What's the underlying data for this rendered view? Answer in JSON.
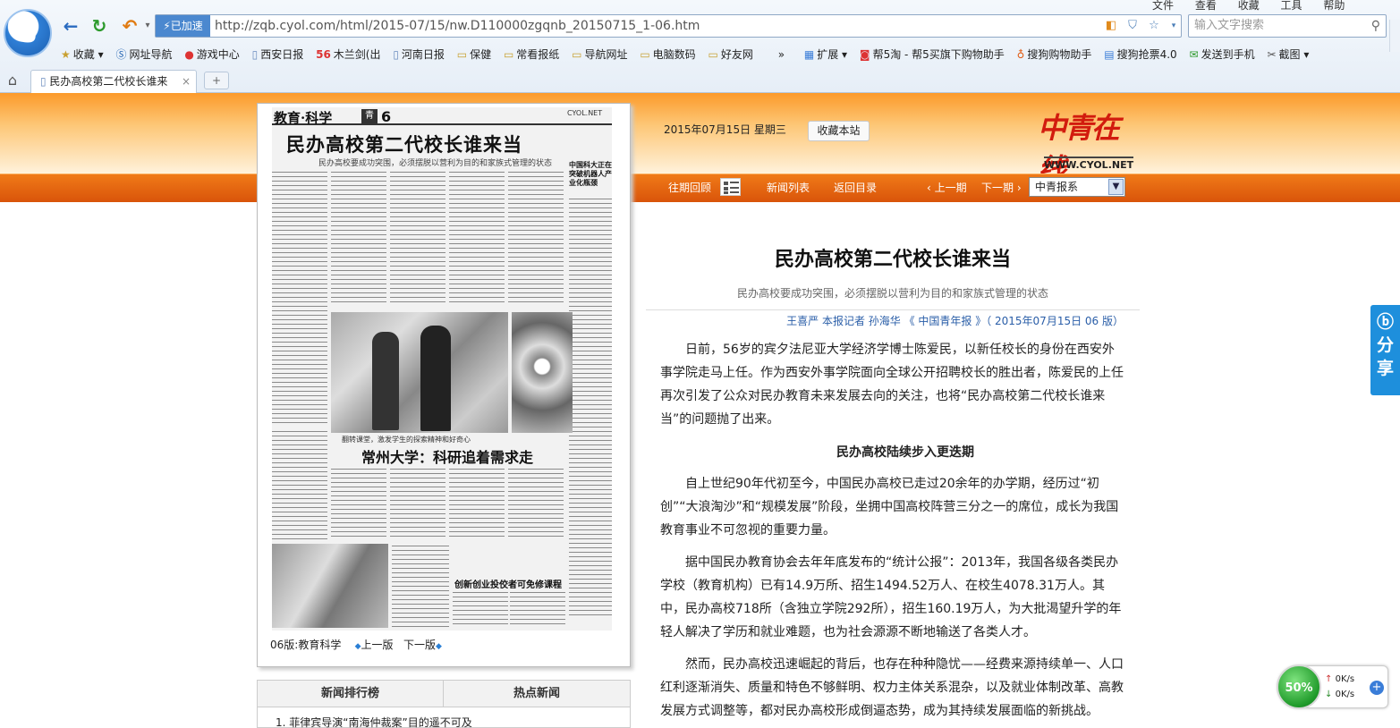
{
  "browser": {
    "speedup_label": "已加速",
    "url": "http://zqb.cyol.com/html/2015-07/15/nw.D110000zgqnb_20150715_1-06.htm",
    "search_placeholder": "输入文字搜索",
    "menu": [
      "文件",
      "查看",
      "收藏",
      "工具",
      "帮助"
    ],
    "bookmarks": [
      "收藏",
      "网址导航",
      "游戏中心",
      "西安日报",
      "木兰剑(出",
      "河南日报",
      "保健",
      "常看报纸",
      "导航网址",
      "电脑数码",
      "好友网",
      "»",
      "扩展",
      "帮5淘 - 帮5买旗下购物助手",
      "搜狗购物助手",
      "搜狗抢票4.0",
      "发送到手机",
      "截图"
    ],
    "tab_title": "民办高校第二代校长谁来",
    "new_tab": "+"
  },
  "site": {
    "date": "2015年07月15日  星期三",
    "favorite_button": "收藏本站",
    "brand": "中青在线",
    "brand_url": "WWW.CYOL.NET",
    "nav": {
      "past": "往期回顾",
      "news_list": "新闻列表",
      "back": "返回目录",
      "prev": "上一期",
      "next": "下一期",
      "paper_select": "中青报系"
    }
  },
  "newspaper": {
    "section": "教育·科学",
    "page_number": "6",
    "headline": "民办高校第二代校长谁来当",
    "subhead": "民办高校要成功突围，必须摆脱以营利为目的和家族式管理的状态",
    "photo_caption": "翻转课堂，激发学生的探索精神和好奇心",
    "headline2": "常州大学：科研追着需求走",
    "headline3": "创新创业投佼者可免修课程",
    "side_headline": "中国科大正在突破机器人产业化瓶颈",
    "page_label": "06版:教育科学",
    "prev_page": "上一版",
    "next_page": "下一版"
  },
  "rankings": {
    "tab1": "新闻排行榜",
    "tab2": "热点新闻",
    "items": [
      "1.   菲律宾导演“南海仲裁案”目的遥不可及"
    ]
  },
  "article": {
    "title": "民办高校第二代校长谁来当",
    "subtitle": "民办高校要成功突围，必须摆脱以营利为目的和家族式管理的状态",
    "byline": "王喜严  本报记者  孙海华  《 中国青年报 》（  2015年07月15日    06 版）",
    "paragraphs": [
      "日前，56岁的宾夕法尼亚大学经济学博士陈爱民，以新任校长的身份在西安外事学院走马上任。作为西安外事学院面向全球公开招聘校长的胜出者，陈爱民的上任再次引发了公众对民办教育未来发展去向的关注，也将“民办高校第二代校长谁来当”的问题抛了出来。",
      "民办高校陆续步入更迭期",
      "自上世纪90年代初至今，中国民办高校已走过20余年的办学期，经历过“初创”“大浪淘沙”和“规模发展”阶段，坐拥中国高校阵营三分之一的席位，成长为我国教育事业不可忽视的重要力量。",
      "据中国民办教育协会去年年底发布的“统计公报”：2013年，我国各级各类民办学校（教育机构）已有14.9万所、招生1494.52万人、在校生4078.31万人。其中，民办高校718所（含独立学院292所），招生160.19万人，为大批渴望升学的年轻人解决了学历和就业难题，也为社会源源不断地输送了各类人才。",
      "然而，民办高校迅速崛起的背后，也存在种种隐忧——经费来源持续单一、人口红利逐渐消失、质量和特色不够鲜明、权力主体关系混杂，以及就业体制改革、高教发展方式调整等，都对民办高校形成倒逼态势，成为其持续发展面临的新挑战。"
    ]
  },
  "widgets": {
    "share": "分享",
    "speed_percent": "50%",
    "upload": "0K/s",
    "download": "0K/s"
  }
}
